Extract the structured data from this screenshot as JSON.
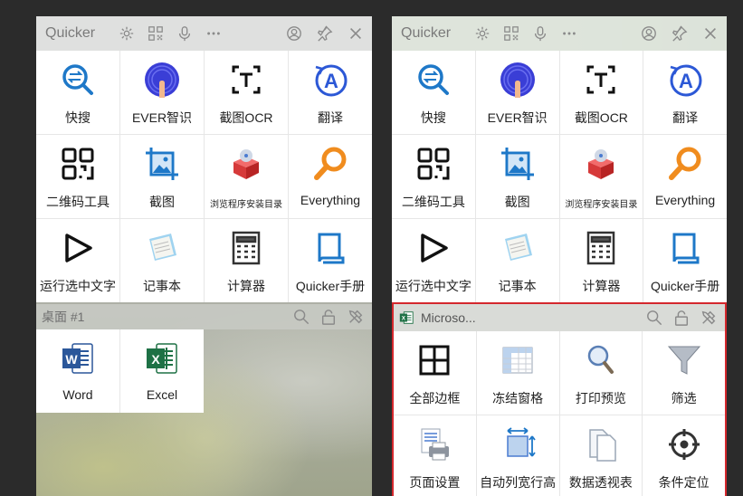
{
  "left_panel": {
    "title": "Quicker",
    "actions": [
      {
        "label": "快搜",
        "icon": "search-swap-icon"
      },
      {
        "label": "EVER智识",
        "icon": "fingerprint-icon"
      },
      {
        "label": "截图OCR",
        "icon": "ocr-text-icon"
      },
      {
        "label": "翻译",
        "icon": "translate-icon"
      },
      {
        "label": "二维码工具",
        "icon": "qr-code-icon"
      },
      {
        "label": "截图",
        "icon": "screenshot-image-icon"
      },
      {
        "label": "浏览程序安装目录",
        "icon": "install-folder-icon"
      },
      {
        "label": "Everything",
        "icon": "everything-search-icon"
      },
      {
        "label": "运行选中文字",
        "icon": "play-icon"
      },
      {
        "label": "记事本",
        "icon": "notepad-icon"
      },
      {
        "label": "计算器",
        "icon": "calculator-icon"
      },
      {
        "label": "Quicker手册",
        "icon": "manual-book-icon"
      }
    ],
    "desktop": {
      "title": "桌面 #1",
      "items": [
        {
          "label": "Word",
          "icon": "word-icon"
        },
        {
          "label": "Excel",
          "icon": "excel-icon"
        }
      ]
    }
  },
  "right_panel": {
    "title": "Quicker",
    "actions": [
      {
        "label": "快搜",
        "icon": "search-swap-icon"
      },
      {
        "label": "EVER智识",
        "icon": "fingerprint-icon"
      },
      {
        "label": "截图OCR",
        "icon": "ocr-text-icon"
      },
      {
        "label": "翻译",
        "icon": "translate-icon"
      },
      {
        "label": "二维码工具",
        "icon": "qr-code-icon"
      },
      {
        "label": "截图",
        "icon": "screenshot-image-icon"
      },
      {
        "label": "浏览程序安装目录",
        "icon": "install-folder-icon"
      },
      {
        "label": "Everything",
        "icon": "everything-search-icon"
      },
      {
        "label": "运行选中文字",
        "icon": "play-icon"
      },
      {
        "label": "记事本",
        "icon": "notepad-icon"
      },
      {
        "label": "计算器",
        "icon": "calculator-icon"
      },
      {
        "label": "Quicker手册",
        "icon": "manual-book-icon"
      }
    ],
    "excel_context": {
      "title": "Microso...",
      "items": [
        {
          "label": "全部边框",
          "icon": "all-borders-icon"
        },
        {
          "label": "冻结窗格",
          "icon": "freeze-panes-icon"
        },
        {
          "label": "打印预览",
          "icon": "print-preview-icon"
        },
        {
          "label": "筛选",
          "icon": "filter-icon"
        },
        {
          "label": "页面设置",
          "icon": "page-setup-icon"
        },
        {
          "label": "自动列宽行高",
          "icon": "autofit-icon"
        },
        {
          "label": "数据透视表",
          "icon": "pivot-table-icon"
        },
        {
          "label": "条件定位",
          "icon": "locate-target-icon"
        }
      ]
    }
  },
  "colors": {
    "accent_blue": "#1e78c8",
    "highlight_red": "#d4282d",
    "orange": "#f08c1e",
    "excel_green": "#1e7145",
    "word_blue": "#2b579a"
  }
}
